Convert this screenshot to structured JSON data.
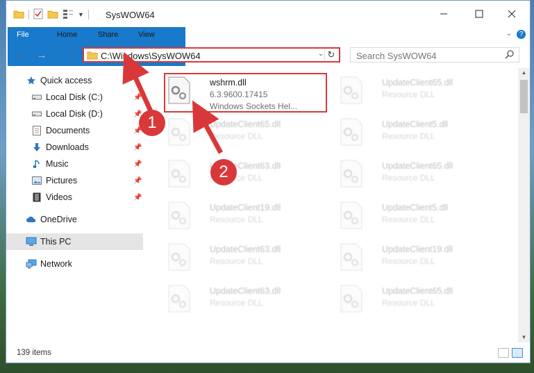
{
  "window": {
    "title": "SysWOW64"
  },
  "ribbon": {
    "tabs": [
      "File",
      "Home",
      "Share",
      "View"
    ]
  },
  "address": {
    "path": "C:\\Windows\\SysWOW64"
  },
  "search": {
    "placeholder": "Search SysWOW64"
  },
  "nav": {
    "quick_access": "Quick access",
    "items": [
      {
        "label": "Local Disk (C:)",
        "icon": "drive-icon",
        "pinned": true
      },
      {
        "label": "Local Disk (D:)",
        "icon": "drive-icon",
        "pinned": true
      },
      {
        "label": "Documents",
        "icon": "documents-icon",
        "pinned": true
      },
      {
        "label": "Downloads",
        "icon": "downloads-icon",
        "pinned": true
      },
      {
        "label": "Music",
        "icon": "music-icon",
        "pinned": true
      },
      {
        "label": "Pictures",
        "icon": "pictures-icon",
        "pinned": true
      },
      {
        "label": "Videos",
        "icon": "videos-icon",
        "pinned": true
      }
    ],
    "onedrive": "OneDrive",
    "this_pc": "This PC",
    "network": "Network"
  },
  "files": [
    {
      "name": "wshrm.dll",
      "version": "6.3.9600.17415",
      "description": "Windows Sockets Hel..."
    },
    {
      "name": "UpdateClient65.dll",
      "description": "Resource DLL"
    },
    {
      "name": "UpdateClient65.dll",
      "description": "Resource DLL"
    },
    {
      "name": "UpdateClient5.dll",
      "description": "Resource DLL"
    },
    {
      "name": "UpdateClient63.dll",
      "description": "Resource DLL"
    },
    {
      "name": "UpdateClient65.dll",
      "description": "Resource DLL"
    },
    {
      "name": "UpdateClient19.dll",
      "description": "Resource DLL"
    },
    {
      "name": "UpdateClient5.dll",
      "description": "Resource DLL"
    },
    {
      "name": "UpdateClient63.dll",
      "description": "Resource DLL"
    },
    {
      "name": "UpdateClient19.dll",
      "description": "Resource DLL"
    },
    {
      "name": "UpdateClient63.dll",
      "description": "Resource DLL"
    },
    {
      "name": "UpdateClient65.dll",
      "description": "Resource DLL"
    }
  ],
  "status": {
    "count": "139 items"
  },
  "annotations": {
    "step1": "1",
    "step2": "2"
  },
  "colors": {
    "accent": "#1979ca",
    "annotation": "#d9383a",
    "selected": "#cce8ff"
  }
}
